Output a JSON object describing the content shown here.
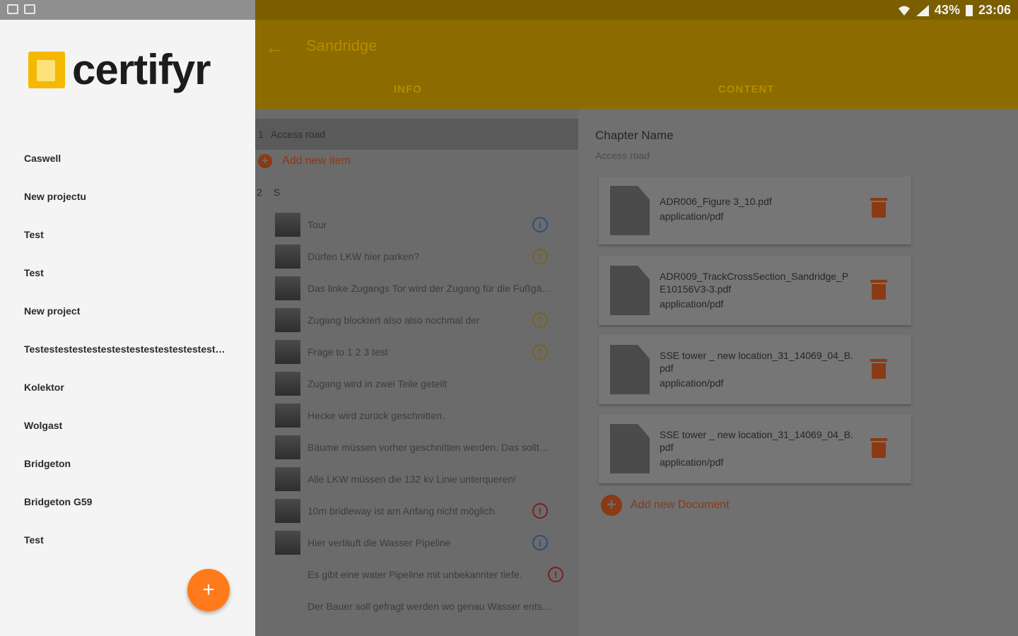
{
  "status_bar": {
    "battery": "43%",
    "time": "23:06"
  },
  "app_bar": {
    "title": "Sandridge",
    "tabs": [
      "INFO",
      "CONTENT"
    ]
  },
  "drawer": {
    "logo_text": "certifyr",
    "projects": [
      "Caswell",
      "New projectu",
      "Test",
      "Test",
      "New project",
      "Testestestestestestestestestestestestest…",
      "Kolektor",
      "Wolgast",
      "Bridgeton",
      "Bridgeton G59",
      "Test"
    ],
    "fab_label": "+"
  },
  "item_list": {
    "section1": {
      "number": "1",
      "title": "Access road"
    },
    "add_item_label": "Add new item",
    "section2": {
      "number": "2",
      "title": "S"
    },
    "items": [
      {
        "text": "Tour",
        "status": "info"
      },
      {
        "text": "Dürfen LKW hier parken?",
        "status": "question"
      },
      {
        "text": "Das linke Zugangs Tor wird der Zugang für die Fußgä…",
        "status": ""
      },
      {
        "text": "Zugang blockiert also also nochmal der",
        "status": "question"
      },
      {
        "text": "Frage to 1 2 3 test",
        "status": "question"
      },
      {
        "text": "Zugang wird in zwei Teile geteilt",
        "status": ""
      },
      {
        "text": "Hecke wird zurück geschnitten.",
        "status": ""
      },
      {
        "text": "Bäume müssen vorher geschnitten werden. Das sollt…",
        "status": ""
      },
      {
        "text": "Alle LKW müssen die 132 kv Linie unterqueren!",
        "status": ""
      },
      {
        "text": "10m bridleway ist am Anfang nicht möglich.",
        "status": "alert"
      },
      {
        "text": "Hier verläuft die Wasser Pipeline",
        "status": "info"
      },
      {
        "text": "Es gibt eine water Pipeline mit unbekannter tiefe.",
        "status": "alert"
      },
      {
        "text": "Der Bauer soll gefragt werden wo genau Wasser ents…",
        "status": ""
      }
    ],
    "status_glyphs": {
      "info": "i",
      "question": "?",
      "alert": "!"
    }
  },
  "content_panel": {
    "chapter_label": "Chapter Name",
    "chapter_value": "Access road",
    "documents": [
      {
        "name": "ADR006_Figure 3_10.pdf",
        "type": "application/pdf"
      },
      {
        "name": "ADR009_TrackCrossSection_Sandridge_PE10156V3-3.pdf",
        "type": "application/pdf"
      },
      {
        "name": "SSE tower _ new location_31_14069_04_B.pdf",
        "type": "application/pdf"
      },
      {
        "name": "SSE tower _ new location_31_14069_04_B.pdf",
        "type": "application/pdf"
      }
    ],
    "add_document_label": "Add new Document"
  },
  "colors": {
    "brand_yellow": "#f5b800",
    "accent_orange": "#ff7a1a",
    "app_bar_dimmed": "#8c6c00"
  }
}
